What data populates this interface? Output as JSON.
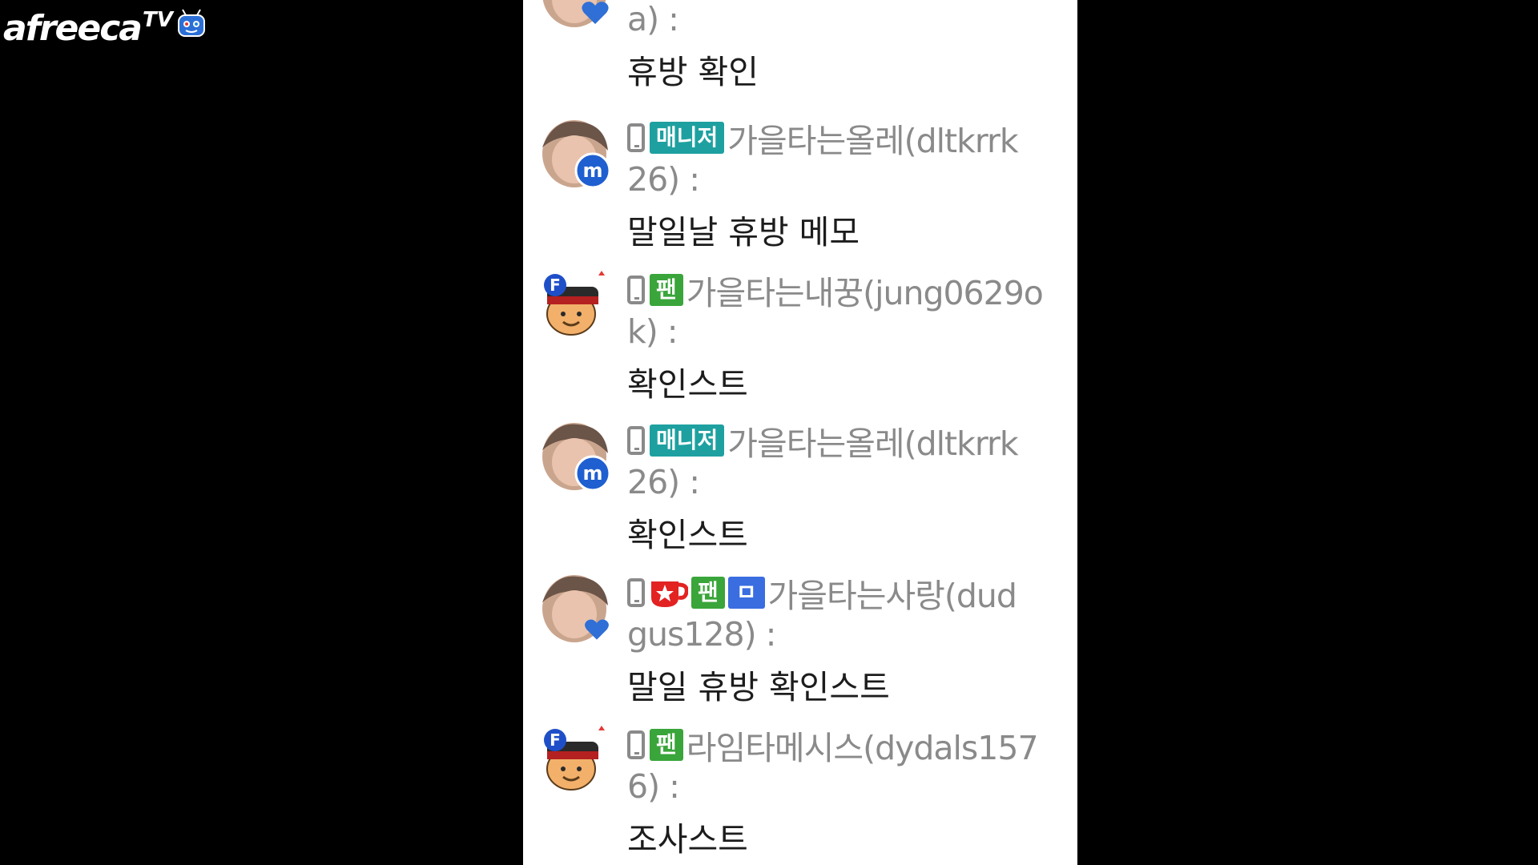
{
  "logo": {
    "text": "afreeca",
    "tv": "TV"
  },
  "messages": [
    {
      "line1": "",
      "line2": "a) :",
      "text": "휴방 확인"
    },
    {
      "badge": "매니저",
      "line1": "가을타는올레(dltkrrk",
      "line2": "26) :",
      "text": "말일날 휴방 메모"
    },
    {
      "badge": "팬",
      "line1": "가을타는내꿍(jung0629o",
      "line2": "k) :",
      "text": "확인스트"
    },
    {
      "badge": "매니저",
      "line1": "가을타는올레(dltkrrk",
      "line2": "26) :",
      "text": "확인스트"
    },
    {
      "badge": "팬",
      "badge2": "ㅁ",
      "line1": "가을타는사랑(dud",
      "line2": "gus128) :",
      "text": "말일 휴방 확인스트"
    },
    {
      "badge": "팬",
      "line1": "라임타메시스(dydals157",
      "line2": "6) :",
      "text": "조사스트"
    }
  ]
}
